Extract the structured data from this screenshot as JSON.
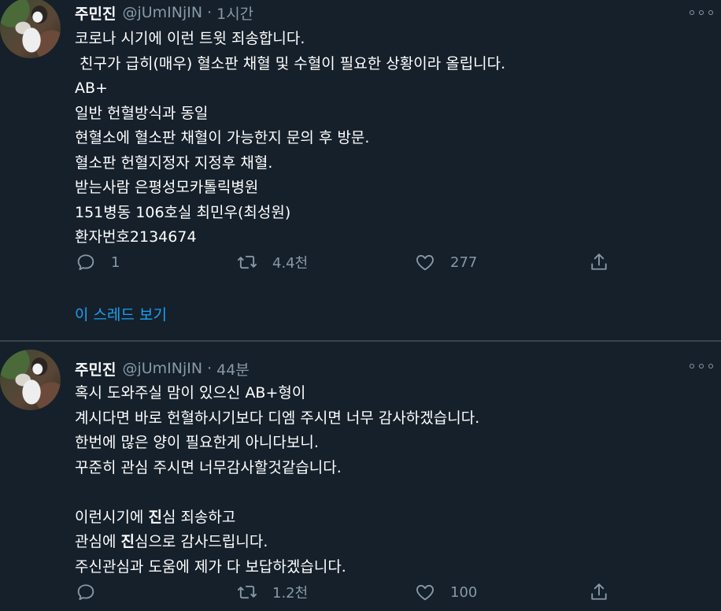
{
  "tweets": [
    {
      "display_name": "주민진",
      "handle": "@jUmINjIN",
      "separator": "·",
      "time": "1시간",
      "lines": [
        "코로나 시기에 이런 트윗 죄송합니다.",
        " 친구가 급히(매우) 혈소판 채혈 및 수혈이 필요한 상황이라 올립니다.",
        "AB+",
        "일반 헌혈방식과 동일",
        "현혈소에 혈소판 채혈이 가능한지 문의 후 방문.",
        "혈소판 헌혈지정자 지정후 채혈.",
        "받는사람 은평성모카톨릭병원",
        "151병동 106호실 최민우(최성원)",
        "환자번호2134674"
      ],
      "reply_count": "1",
      "retweet_count": "4.4천",
      "like_count": "277",
      "thread_link": "이 스레드 보기"
    },
    {
      "display_name": "주민진",
      "handle": "@jUmINjIN",
      "separator": "·",
      "time": "44분",
      "lines": [
        "혹시 도와주실 맘이 있으신 AB+형이",
        "계시다면 바로 헌혈하시기보다 디엠 주시면 너무 감사하겠습니다.",
        "한번에 많은 양이 필요한게 아니다보니.",
        "꾸준히 관심 주시면 너무감사할것같습니다.",
        "",
        "이런시기에 진심 죄송하고",
        "관심에 진심으로 감사드립니다.",
        "주신관심과 도움에 제가 다 보답하겠습니다."
      ],
      "reply_count": "",
      "retweet_count": "1.2천",
      "like_count": "100"
    }
  ],
  "colors": {
    "background": "#15202b",
    "text": "#ffffff",
    "secondary": "#8899a6",
    "link": "#1da1f2",
    "divider": "#38444d"
  },
  "icons": {
    "reply": "reply-icon",
    "retweet": "retweet-icon",
    "like": "heart-icon",
    "share": "share-icon",
    "more": "more-icon"
  }
}
